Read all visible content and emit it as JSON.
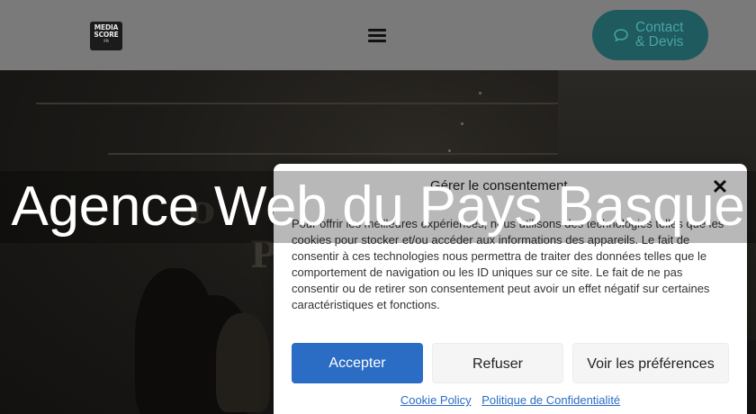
{
  "header": {
    "logo": {
      "line1": "MEDIA",
      "line2": "SCORE",
      "line3": "FR"
    },
    "contact_label": "Contact & Devis"
  },
  "hero": {
    "title": "Agence Web du Pays Basque",
    "ghost_text_1": "o",
    "ghost_text_2": "P"
  },
  "consent": {
    "title": "Gérer le consentement",
    "body": "Pour offrir les meilleures expériences, nous utilisons des technologies telles que les cookies pour stocker et/ou accéder aux informations des appareils. Le fait de consentir à ces technologies nous permettra de traiter des données telles que le comportement de navigation ou les ID uniques sur ce site. Le fait de ne pas consentir ou de retirer son consentement peut avoir un effet négatif sur certaines caractéristiques et fonctions.",
    "accept_label": "Accepter",
    "refuse_label": "Refuser",
    "prefs_label": "Voir les préférences",
    "cookie_policy": "Cookie Policy",
    "privacy_policy": "Politique de Confidentialité"
  },
  "colors": {
    "accent_blue": "#2b6cc4",
    "contact_bg": "#1e5a5e",
    "header_bg": "#7a7a7a"
  }
}
